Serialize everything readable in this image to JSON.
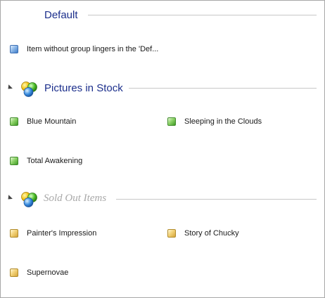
{
  "groups": [
    {
      "title": "Default",
      "items": [
        {
          "label": "Item without group lingers in the 'Def...",
          "color": "#5f93d6"
        }
      ]
    },
    {
      "title": "Pictures in Stock",
      "expander_icon": "expanded-triangle-icon",
      "icon": "group-balls-icon",
      "items": [
        {
          "label": "Blue Mountain",
          "color": "#6cc24a"
        },
        {
          "label": "Sleeping in the Clouds",
          "color": "#6cc24a"
        },
        {
          "label": "Total Awakening",
          "color": "#6cc24a"
        }
      ]
    },
    {
      "title": "Sold Out Items",
      "expander_icon": "expanded-triangle-icon",
      "icon": "group-balls-icon",
      "items": [
        {
          "label": "Painter's Impression",
          "color": "#ecc35a"
        },
        {
          "label": "Story of Chucky",
          "color": "#ecc35a"
        },
        {
          "label": "Supernovae",
          "color": "#ecc35a"
        }
      ]
    }
  ]
}
